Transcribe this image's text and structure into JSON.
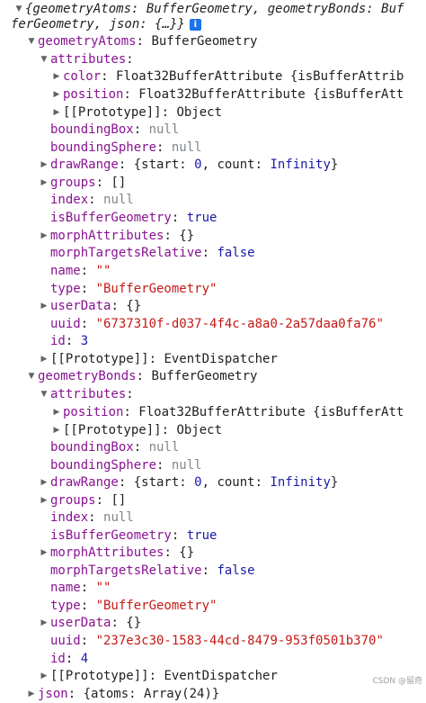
{
  "lines": [
    {
      "k": "tri",
      "tri": "▼",
      "line1": "{geometryAtoms: BufferGeometry, geometryBonds: Buf",
      "line2": "ferGeometry, json: {…}}",
      "info": "i"
    },
    {
      "tri": "▼",
      "key": "geometryAtoms",
      "sep": ": ",
      "val": "BufferGeometry",
      "vt": "obj"
    },
    {
      "tri": "▼",
      "key": "attributes",
      "sep": ":",
      "val": "",
      "vt": "obj"
    },
    {
      "tri": "▶",
      "key": "color",
      "sep": ": ",
      "val": "Float32BufferAttribute {isBufferAttrib",
      "vt": "obj"
    },
    {
      "tri": "▶",
      "key": "position",
      "sep": ": ",
      "val": "Float32BufferAttribute {isBufferAtt",
      "vt": "obj"
    },
    {
      "tri": "▶",
      "proto": "[[Prototype]]",
      "sep": ": ",
      "val": "Object",
      "vt": "obj"
    },
    {
      "key": "boundingBox",
      "sep": ": ",
      "val": "null",
      "vt": "null"
    },
    {
      "key": "boundingSphere",
      "sep": ": ",
      "val": "null",
      "vt": "null"
    },
    {
      "tri": "▶",
      "key": "drawRange",
      "sep": ": ",
      "parts": [
        [
          "{start: ",
          "obj"
        ],
        [
          "0",
          "num"
        ],
        [
          ", count: ",
          "obj"
        ],
        [
          "Infinity",
          "num"
        ],
        [
          "}",
          "obj"
        ]
      ]
    },
    {
      "tri": "▶",
      "key": "groups",
      "sep": ": ",
      "val": "[]",
      "vt": "obj"
    },
    {
      "key": "index",
      "sep": ": ",
      "val": "null",
      "vt": "null"
    },
    {
      "key": "isBufferGeometry",
      "sep": ": ",
      "val": "true",
      "vt": "bool"
    },
    {
      "tri": "▶",
      "key": "morphAttributes",
      "sep": ": ",
      "val": "{}",
      "vt": "obj"
    },
    {
      "key": "morphTargetsRelative",
      "sep": ": ",
      "val": "false",
      "vt": "bool"
    },
    {
      "key": "name",
      "sep": ": ",
      "val": "\"\"",
      "vt": "str"
    },
    {
      "key": "type",
      "sep": ": ",
      "val": "\"BufferGeometry\"",
      "vt": "str"
    },
    {
      "tri": "▶",
      "key": "userData",
      "sep": ": ",
      "val": "{}",
      "vt": "obj"
    },
    {
      "key": "uuid",
      "sep": ": ",
      "val": "\"6737310f-d037-4f4c-a8a0-2a57daa0fa76\"",
      "vt": "str"
    },
    {
      "key": "id",
      "sep": ": ",
      "val": "3",
      "vt": "num"
    },
    {
      "tri": "▶",
      "proto": "[[Prototype]]",
      "sep": ": ",
      "val": "EventDispatcher",
      "vt": "obj"
    },
    {
      "tri": "▼",
      "key": "geometryBonds",
      "sep": ": ",
      "val": "BufferGeometry",
      "vt": "obj"
    },
    {
      "tri": "▼",
      "key": "attributes",
      "sep": ":",
      "val": "",
      "vt": "obj"
    },
    {
      "tri": "▶",
      "key": "position",
      "sep": ": ",
      "val": "Float32BufferAttribute {isBufferAtt",
      "vt": "obj"
    },
    {
      "tri": "▶",
      "proto": "[[Prototype]]",
      "sep": ": ",
      "val": "Object",
      "vt": "obj"
    },
    {
      "key": "boundingBox",
      "sep": ": ",
      "val": "null",
      "vt": "null"
    },
    {
      "key": "boundingSphere",
      "sep": ": ",
      "val": "null",
      "vt": "null"
    },
    {
      "tri": "▶",
      "key": "drawRange",
      "sep": ": ",
      "parts": [
        [
          "{start: ",
          "obj"
        ],
        [
          "0",
          "num"
        ],
        [
          ", count: ",
          "obj"
        ],
        [
          "Infinity",
          "num"
        ],
        [
          "}",
          "obj"
        ]
      ]
    },
    {
      "tri": "▶",
      "key": "groups",
      "sep": ": ",
      "val": "[]",
      "vt": "obj"
    },
    {
      "key": "index",
      "sep": ": ",
      "val": "null",
      "vt": "null"
    },
    {
      "key": "isBufferGeometry",
      "sep": ": ",
      "val": "true",
      "vt": "bool"
    },
    {
      "tri": "▶",
      "key": "morphAttributes",
      "sep": ": ",
      "val": "{}",
      "vt": "obj"
    },
    {
      "key": "morphTargetsRelative",
      "sep": ": ",
      "val": "false",
      "vt": "bool"
    },
    {
      "key": "name",
      "sep": ": ",
      "val": "\"\"",
      "vt": "str"
    },
    {
      "key": "type",
      "sep": ": ",
      "val": "\"BufferGeometry\"",
      "vt": "str"
    },
    {
      "tri": "▶",
      "key": "userData",
      "sep": ": ",
      "val": "{}",
      "vt": "obj"
    },
    {
      "key": "uuid",
      "sep": ": ",
      "val": "\"237e3c30-1583-44cd-8479-953f0501b370\"",
      "vt": "str"
    },
    {
      "key": "id",
      "sep": ": ",
      "val": "4",
      "vt": "num"
    },
    {
      "tri": "▶",
      "proto": "[[Prototype]]",
      "sep": ": ",
      "val": "EventDispatcher",
      "vt": "obj"
    },
    {
      "tri": "▶",
      "key": "json",
      "sep": ": ",
      "val": "{atoms: Array(24)}",
      "vt": "obj"
    }
  ],
  "watermark": "CSDN @留奇"
}
